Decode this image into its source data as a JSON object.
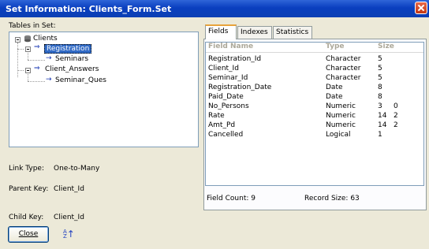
{
  "window": {
    "title": "Set Information: Clients_Form.Set"
  },
  "tree": {
    "label": "Tables in Set:",
    "root": "Clients",
    "items": [
      {
        "label": "Registration",
        "selected": true
      },
      {
        "label": "Seminars"
      },
      {
        "label": "Client_Answers"
      },
      {
        "label": "Seminar_Ques"
      }
    ]
  },
  "info": {
    "link_type": "Link Type:",
    "link_type_value": "One-to-Many",
    "parent_key": "Parent Key:",
    "parent_key_value": "Client_Id",
    "child_key": "Child Key:",
    "child_key_value": "Client_Id"
  },
  "tabs": [
    {
      "label": "Fields",
      "active": true
    },
    {
      "label": "Indexes"
    },
    {
      "label": "Statistics"
    }
  ],
  "table": {
    "columns": [
      "Field Name",
      "Type",
      "Size"
    ],
    "rows": [
      [
        "Registration_Id",
        "Character",
        "5",
        ""
      ],
      [
        "Client_Id",
        "Character",
        "5",
        ""
      ],
      [
        "Seminar_Id",
        "Character",
        "5",
        ""
      ],
      [
        "Registration_Date",
        "Date",
        "8",
        ""
      ],
      [
        "Paid_Date",
        "Date",
        "8",
        ""
      ],
      [
        "No_Persons",
        "Numeric",
        "3",
        "0"
      ],
      [
        "Rate",
        "Numeric",
        "14",
        "2"
      ],
      [
        "Amt_Pd",
        "Numeric",
        "14",
        "2"
      ],
      [
        "Cancelled",
        "Logical",
        "1",
        ""
      ]
    ]
  },
  "footer": {
    "field_count": "Field Count: 9",
    "record_size": "Record Size: 63"
  },
  "buttons": {
    "close": "Close",
    "sort_icon": "sort-az-icon"
  }
}
